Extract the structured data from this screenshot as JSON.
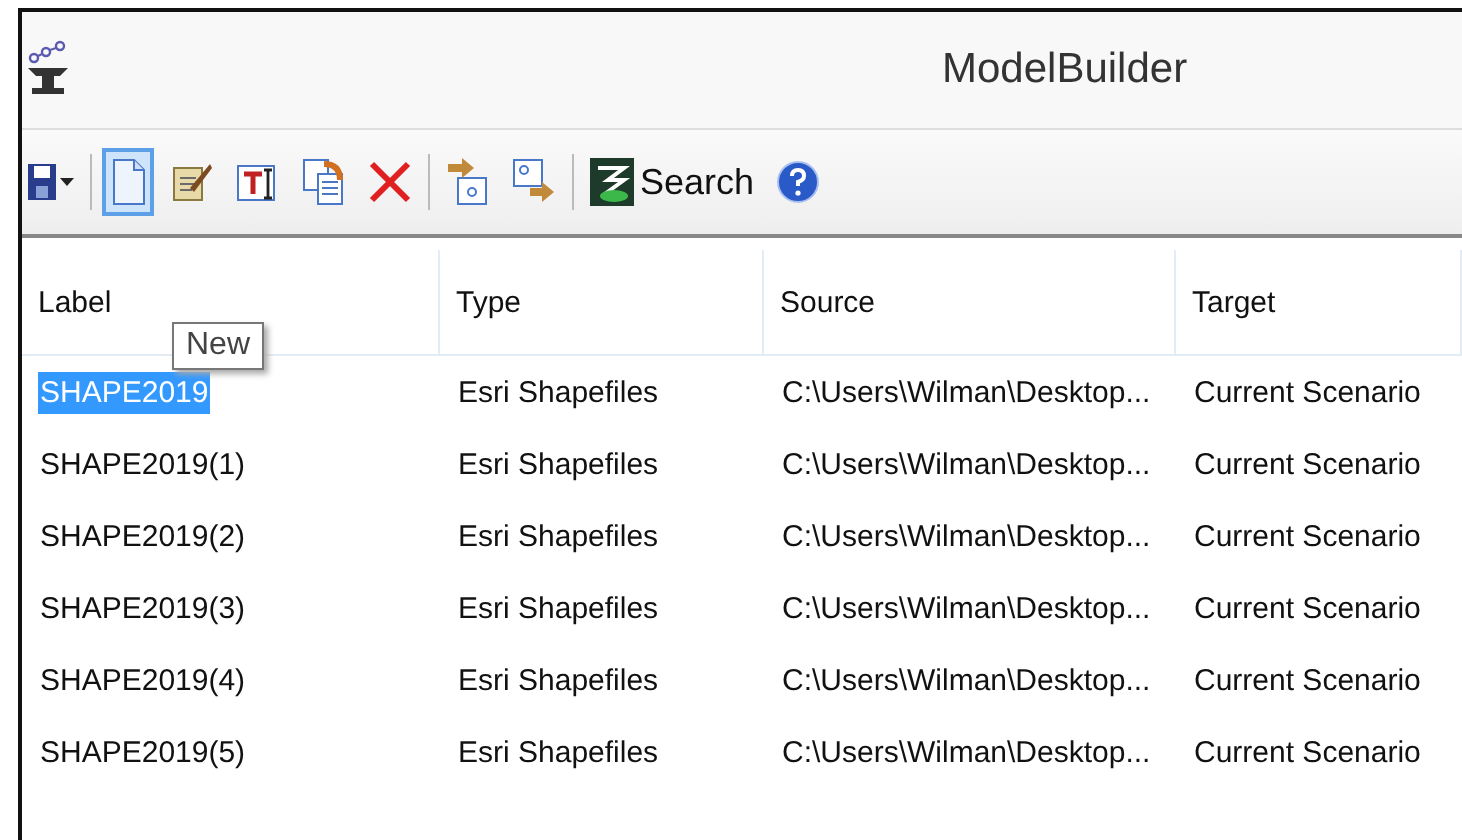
{
  "window": {
    "title": "ModelBuilder"
  },
  "toolbar": [
    {
      "kind": "save",
      "selected": false
    },
    {
      "kind": "separator"
    },
    {
      "kind": "new",
      "selected": true
    },
    {
      "kind": "edit",
      "selected": false
    },
    {
      "kind": "rename",
      "selected": false
    },
    {
      "kind": "copy",
      "selected": false
    },
    {
      "kind": "delete",
      "selected": false
    },
    {
      "kind": "separator"
    },
    {
      "kind": "import",
      "selected": false
    },
    {
      "kind": "export",
      "selected": false
    },
    {
      "kind": "separator"
    },
    {
      "kind": "search",
      "label": "Search",
      "selected": false
    },
    {
      "kind": "help",
      "selected": false
    }
  ],
  "tooltip": {
    "text": "New"
  },
  "table": {
    "columns": [
      "Label",
      "Type",
      "Source",
      "Target"
    ],
    "rows": [
      {
        "selected": true,
        "cells": [
          "SHAPE2019",
          "Esri Shapefiles",
          "C:\\Users\\Wilman\\Desktop...",
          "Current Scenario"
        ]
      },
      {
        "selected": false,
        "cells": [
          "SHAPE2019(1)",
          "Esri Shapefiles",
          "C:\\Users\\Wilman\\Desktop...",
          "Current Scenario"
        ]
      },
      {
        "selected": false,
        "cells": [
          "SHAPE2019(2)",
          "Esri Shapefiles",
          "C:\\Users\\Wilman\\Desktop...",
          "Current Scenario"
        ]
      },
      {
        "selected": false,
        "cells": [
          "SHAPE2019(3)",
          "Esri Shapefiles",
          "C:\\Users\\Wilman\\Desktop...",
          "Current Scenario"
        ]
      },
      {
        "selected": false,
        "cells": [
          "SHAPE2019(4)",
          "Esri Shapefiles",
          "C:\\Users\\Wilman\\Desktop...",
          "Current Scenario"
        ]
      },
      {
        "selected": false,
        "cells": [
          "SHAPE2019(5)",
          "Esri Shapefiles",
          "C:\\Users\\Wilman\\Desktop...",
          "Current Scenario"
        ]
      }
    ]
  }
}
